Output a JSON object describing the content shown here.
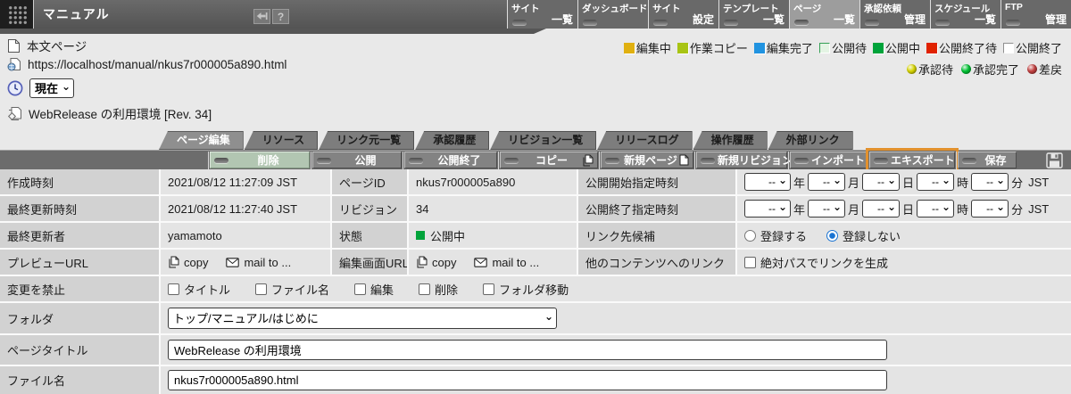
{
  "header": {
    "app_title": "マニュアル",
    "help_label": "?",
    "nav_tabs": [
      {
        "line1": "サイト",
        "line2": "一覧"
      },
      {
        "line1": "ダッシュボード",
        "line2": ""
      },
      {
        "line1": "サイト",
        "line2": "設定"
      },
      {
        "line1": "テンプレート",
        "line2": "一覧"
      },
      {
        "line1": "ページ",
        "line2": "一覧"
      },
      {
        "line1": "承認依頼",
        "line2": "管理"
      },
      {
        "line1": "スケジュール",
        "line2": "一覧"
      },
      {
        "line1": "FTP",
        "line2": "管理"
      }
    ],
    "active_nav": "ページ一覧"
  },
  "info": {
    "page_type": "本文ページ",
    "url": "https://localhost/manual/nkus7r000005a890.html",
    "version_selected": "現在",
    "page_heading": "WebRelease の利用環境 [Rev. 34]"
  },
  "legend": {
    "statuses": [
      {
        "label": "編集中",
        "color": "#e0b010"
      },
      {
        "label": "作業コピー",
        "color": "#a8c414"
      },
      {
        "label": "編集完了",
        "color": "#2193e0"
      },
      {
        "label": "公開待",
        "color": "#e4f4e4"
      },
      {
        "label": "公開中",
        "color": "#00a33a"
      },
      {
        "label": "公開終了待",
        "color": "#e02200"
      },
      {
        "label": "公開終了",
        "color": "#ffffff"
      }
    ],
    "approvals": [
      {
        "label": "承認待",
        "color": "#d6d400"
      },
      {
        "label": "承認完了",
        "color": "#00c233"
      },
      {
        "label": "差戻",
        "color": "#c24040"
      }
    ]
  },
  "tabs": {
    "items": [
      "ページ編集",
      "リソース",
      "リンク元一覧",
      "承認履歴",
      "リビジョン一覧",
      "リリースログ",
      "操作履歴",
      "外部リンク"
    ],
    "active": "ページ編集"
  },
  "toolbar": {
    "delete": "削除",
    "publish": "公開",
    "unpublish": "公開終了",
    "copy": "コピー",
    "new_page": "新規ページ",
    "new_revision": "新規リビジョン",
    "import": "インポート",
    "export": "エキスポート",
    "save": "保存",
    "highlight_color": "#e2912e"
  },
  "table": {
    "created": {
      "label": "作成時刻",
      "value": "2021/08/12 11:27:09 JST"
    },
    "updated": {
      "label": "最終更新時刻",
      "value": "2021/08/12 11:27:40 JST"
    },
    "updater": {
      "label": "最終更新者",
      "value": "yamamoto"
    },
    "page_id": {
      "label": "ページID",
      "value": "nkus7r000005a890"
    },
    "revision": {
      "label": "リビジョン",
      "value": "34"
    },
    "status": {
      "label": "状態",
      "value": "公開中",
      "color": "#00a33a"
    },
    "publish_start": {
      "label": "公開開始指定時刻"
    },
    "publish_end": {
      "label": "公開終了指定時刻"
    },
    "link_candidate": {
      "label": "リンク先候補",
      "options": [
        "登録する",
        "登録しない"
      ],
      "selected": "登録しない"
    },
    "preview_url": {
      "label": "プレビューURL",
      "copy": "copy",
      "mail": "mail to ..."
    },
    "edit_url": {
      "label": "編集画面URL",
      "copy": "copy",
      "mail": "mail to ..."
    },
    "other_link": {
      "label": "他のコンテンツへのリンク",
      "checkbox": "絶対パスでリンクを生成"
    },
    "forbid": {
      "label": "変更を禁止",
      "checkboxes": [
        "タイトル",
        "ファイル名",
        "編集",
        "削除",
        "フォルダ移動"
      ]
    },
    "folder": {
      "label": "フォルダ",
      "value": "トップ/マニュアル/はじめに"
    },
    "page_title": {
      "label": "ページタイトル",
      "value": "WebRelease の利用環境"
    },
    "file_name": {
      "label": "ファイル名",
      "value": "nkus7r000005a890.html"
    },
    "datetime": {
      "placeholder": "--",
      "units": [
        "年",
        "月",
        "日",
        "時",
        "分"
      ],
      "tz": "JST"
    }
  }
}
